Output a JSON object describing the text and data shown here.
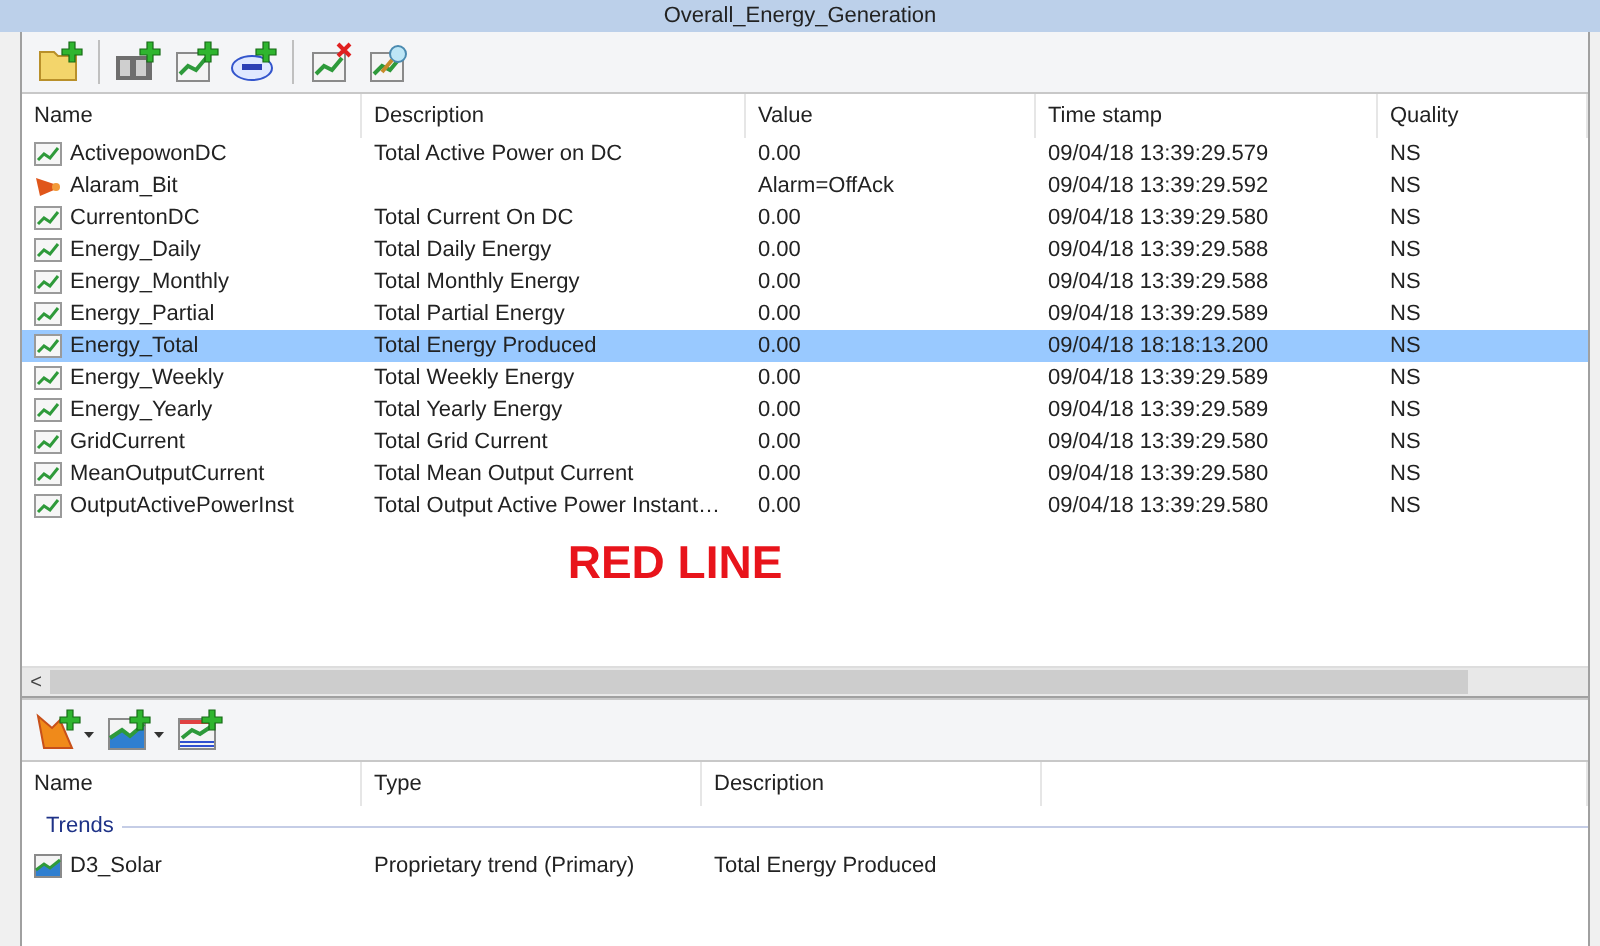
{
  "window": {
    "title": "Overall_Energy_Generation"
  },
  "variables_table": {
    "columns": [
      "Name",
      "Description",
      "Value",
      "Time stamp",
      "Quality"
    ],
    "rows": [
      {
        "kind": "trend",
        "selected": false,
        "cells": [
          "ActivepowonDC",
          "Total Active Power on DC",
          "0.00",
          "09/04/18 13:39:29.579",
          "NS"
        ]
      },
      {
        "kind": "alarm",
        "selected": false,
        "cells": [
          "Alaram_Bit",
          "",
          "Alarm=OffAck",
          "09/04/18 13:39:29.592",
          "NS"
        ]
      },
      {
        "kind": "trend",
        "selected": false,
        "cells": [
          "CurrentonDC",
          "Total Current On DC",
          "0.00",
          "09/04/18 13:39:29.580",
          "NS"
        ]
      },
      {
        "kind": "trend",
        "selected": false,
        "cells": [
          "Energy_Daily",
          "Total Daily Energy",
          "0.00",
          "09/04/18 13:39:29.588",
          "NS"
        ]
      },
      {
        "kind": "trend",
        "selected": false,
        "cells": [
          "Energy_Monthly",
          "Total Monthly Energy",
          "0.00",
          "09/04/18 13:39:29.588",
          "NS"
        ]
      },
      {
        "kind": "trend",
        "selected": false,
        "cells": [
          "Energy_Partial",
          "Total Partial Energy",
          "0.00",
          "09/04/18 13:39:29.589",
          "NS"
        ]
      },
      {
        "kind": "trend",
        "selected": true,
        "cells": [
          "Energy_Total",
          "Total Energy Produced",
          "0.00",
          "09/04/18 18:18:13.200",
          "NS"
        ]
      },
      {
        "kind": "trend",
        "selected": false,
        "cells": [
          "Energy_Weekly",
          "Total Weekly Energy",
          "0.00",
          "09/04/18 13:39:29.589",
          "NS"
        ]
      },
      {
        "kind": "trend",
        "selected": false,
        "cells": [
          "Energy_Yearly",
          "Total Yearly Energy",
          "0.00",
          "09/04/18 13:39:29.589",
          "NS"
        ]
      },
      {
        "kind": "trend",
        "selected": false,
        "cells": [
          "GridCurrent",
          "Total Grid Current",
          "0.00",
          "09/04/18 13:39:29.580",
          "NS"
        ]
      },
      {
        "kind": "trend",
        "selected": false,
        "cells": [
          "MeanOutputCurrent",
          "Total Mean Output Current",
          "0.00",
          "09/04/18 13:39:29.580",
          "NS"
        ]
      },
      {
        "kind": "trend",
        "selected": false,
        "cells": [
          "OutputActivePowerInst",
          "Total Output Active Power Instant…",
          "0.00",
          "09/04/18 13:39:29.580",
          "NS"
        ]
      }
    ]
  },
  "annotation": "RED LINE",
  "scrollbar": {
    "left_arrow": "<"
  },
  "trends_table": {
    "columns": [
      "Name",
      "Type",
      "Description"
    ],
    "groups": [
      {
        "title": "Trends",
        "rows": [
          {
            "cells": [
              "D3_Solar",
              "Proprietary trend (Primary)",
              "Total Energy Produced"
            ]
          }
        ]
      }
    ]
  }
}
